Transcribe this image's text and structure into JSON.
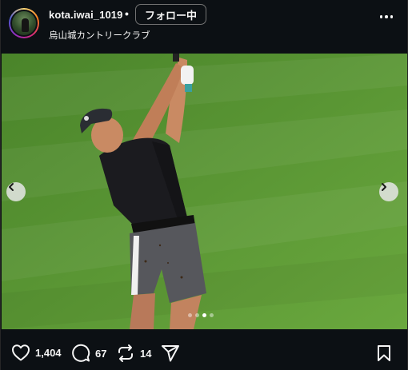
{
  "header": {
    "username": "kota.iwai_1019",
    "separator": "•",
    "follow_label": "フォロー中",
    "location": "烏山城カントリークラブ"
  },
  "icons": {
    "avatar": "profile-avatar",
    "more": "more-options-icon",
    "prev": "chevron-left-icon",
    "next": "chevron-right-icon",
    "like": "heart-icon",
    "comment": "comment-icon",
    "repost": "repost-icon",
    "share": "paper-plane-icon",
    "save": "bookmark-icon"
  },
  "carousel": {
    "slide_count": 4,
    "active_index": 2
  },
  "actions": {
    "likes": "1,404",
    "comments": "67",
    "reposts": "14"
  },
  "colors": {
    "background": "#0c1014",
    "text": "#f5f5f5",
    "grass": "#5c9a36"
  }
}
